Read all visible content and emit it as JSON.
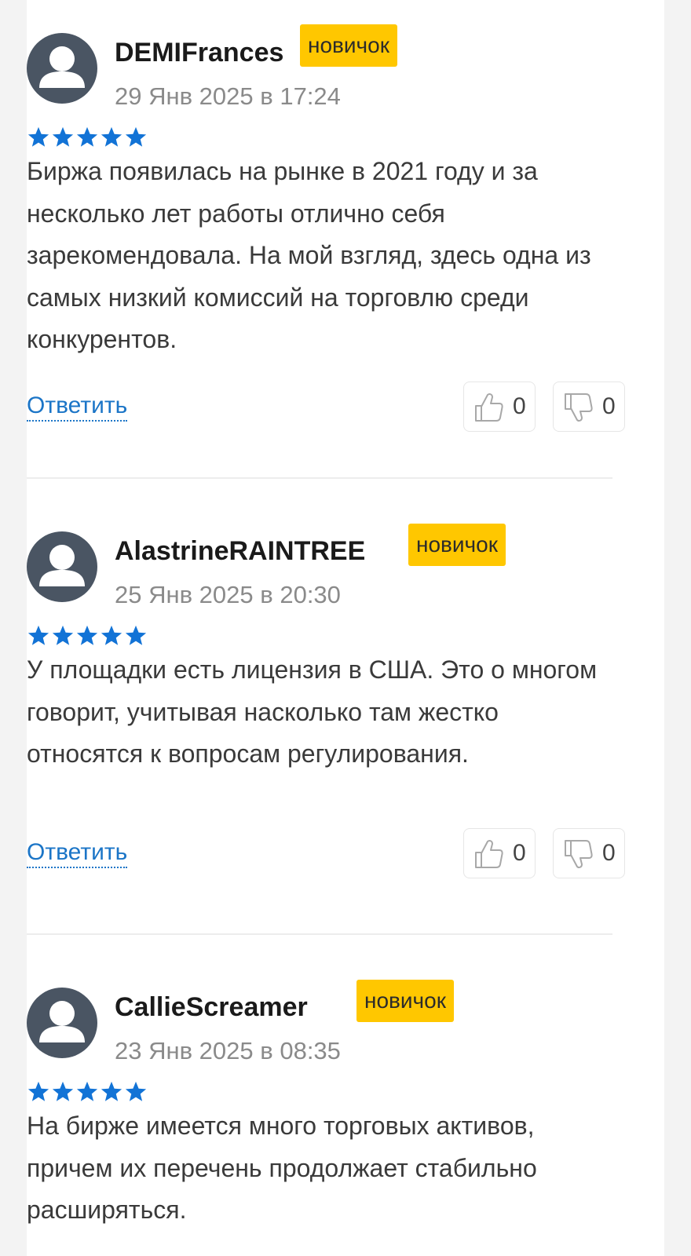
{
  "reviews": [
    {
      "author": "DEMIFrances",
      "badge": "новичок",
      "date": "29 Янв 2025 в 17:24",
      "rating": 5,
      "text": "Биржа появилась на рынке в 2021 году и за несколько лет работы отлично себя зарекомендовала. На мой взгляд, здесь одна из самых низкий комиссий на торговлю среди конкурентов.",
      "reply_label": "Ответить",
      "likes": "0",
      "dislikes": "0"
    },
    {
      "author": "AlastrineRAINTREE",
      "badge": "новичок",
      "date": "25 Янв 2025 в 20:30",
      "rating": 5,
      "text": "У площадки есть лицензия в США. Это о многом говорит, учитывая насколько там жестко относятся к вопросам регулирования.",
      "reply_label": "Ответить",
      "likes": "0",
      "dislikes": "0"
    },
    {
      "author": "CallieScreamer",
      "badge": "новичок",
      "date": "23 Янв 2025 в 08:35",
      "rating": 5,
      "text": "На бирже имеется много торговых активов, причем их перечень продолжает стабильно расширяться."
    }
  ],
  "colors": {
    "star": "#1273d6",
    "badge": "#ffc700",
    "link": "#1b75c7",
    "avatar": "#4a5563"
  },
  "icons": {
    "avatar": "user-avatar-icon",
    "star": "star-icon",
    "like": "thumbs-up-icon",
    "dislike": "thumbs-down-icon"
  }
}
